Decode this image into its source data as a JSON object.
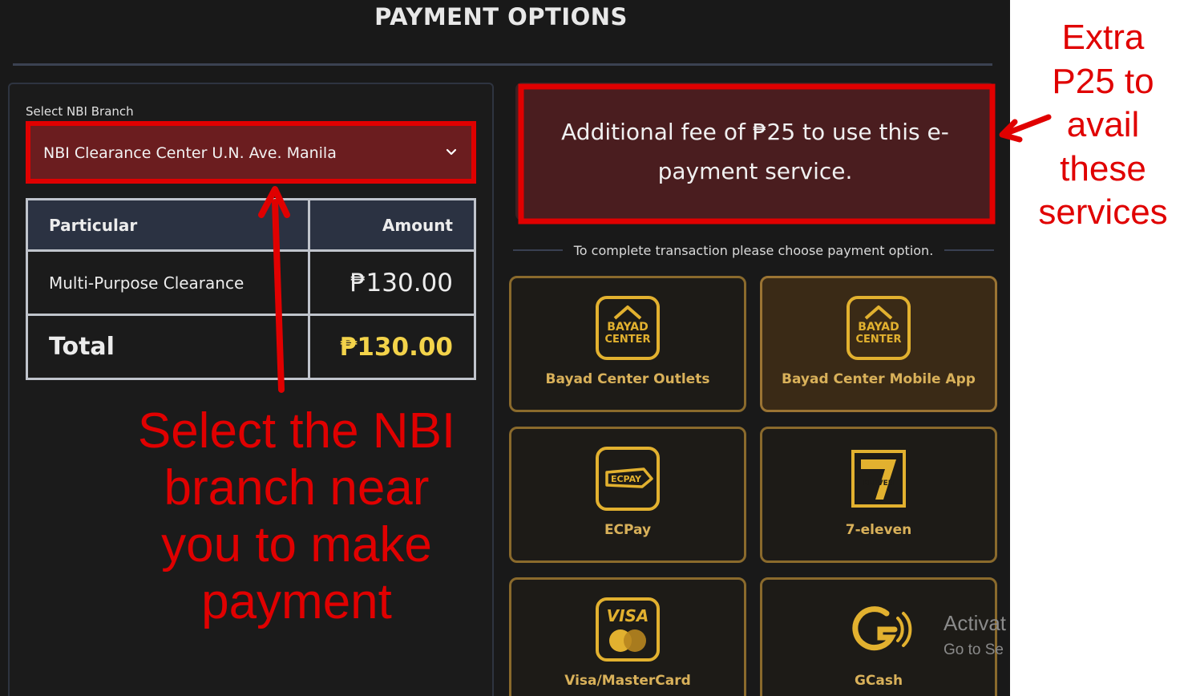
{
  "page": {
    "title": "PAYMENT OPTIONS"
  },
  "branch": {
    "label": "Select NBI Branch",
    "selected": "NBI Clearance Center U.N. Ave. Manila"
  },
  "fee_table": {
    "headers": [
      "Particular",
      "Amount"
    ],
    "rows": [
      {
        "particular": "Multi-Purpose Clearance",
        "amount": "₱130.00"
      }
    ],
    "total_label": "Total",
    "total_amount": "₱130.00"
  },
  "notice": {
    "text": "Additional fee of ₱25 to use this e-payment service."
  },
  "instruction": "To complete transaction please choose payment option.",
  "payment_options": [
    {
      "label": "Bayad Center Outlets",
      "icon": "bayad-center-icon",
      "selected": false
    },
    {
      "label": "Bayad Center Mobile App",
      "icon": "bayad-center-icon",
      "selected": true
    },
    {
      "label": "ECPay",
      "icon": "ecpay-icon",
      "selected": false
    },
    {
      "label": "7-eleven",
      "icon": "seven-eleven-icon",
      "selected": false
    },
    {
      "label": "Visa/MasterCard",
      "icon": "visa-mastercard-icon",
      "selected": false
    },
    {
      "label": "GCash",
      "icon": "gcash-icon",
      "selected": false
    }
  ],
  "icon_text": {
    "bayad_line1": "BAYAD",
    "bayad_line2": "CENTER",
    "ecpay": "ECPAY",
    "seven_eleven": "ELEVEN",
    "visa": "VISA"
  },
  "annotations": {
    "select_branch": [
      "Select the NBI",
      "branch near",
      "you to make",
      "payment"
    ],
    "extra_fee": [
      "Extra",
      "P25 to",
      "avail",
      "these",
      "services"
    ]
  },
  "watermark": {
    "line1": "Activat",
    "line2": "Go to Se"
  },
  "colors": {
    "accent_gold": "#d9b15a",
    "annotation_red": "#e00000",
    "total_yellow": "#f3d34a",
    "select_bg": "#6b1d1f"
  }
}
